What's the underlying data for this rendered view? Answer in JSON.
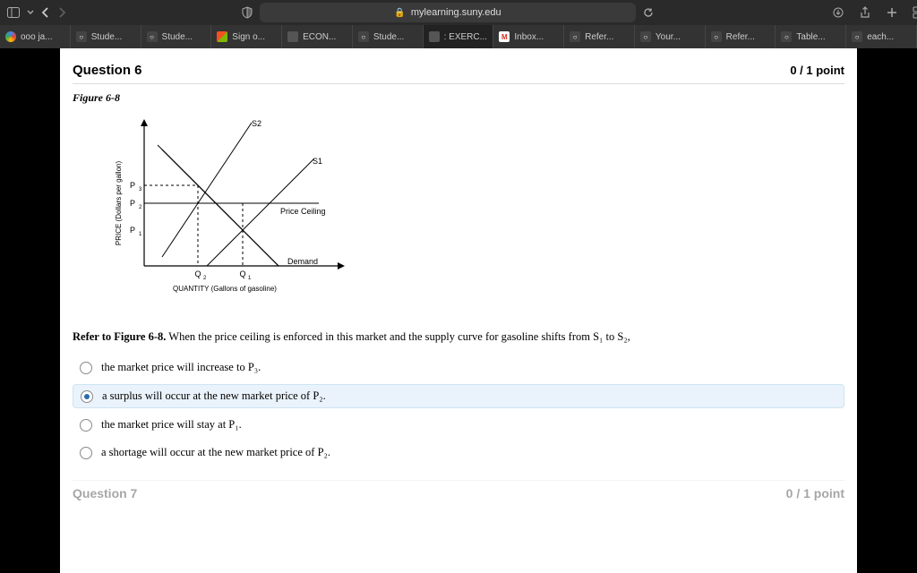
{
  "browser": {
    "address": "mylearning.suny.edu",
    "tabs": [
      {
        "label": "ооо ја...",
        "favicon": "g"
      },
      {
        "label": "Stude...",
        "favicon": "sq"
      },
      {
        "label": "Stude...",
        "favicon": "sq"
      },
      {
        "label": "Sign o...",
        "favicon": "ms"
      },
      {
        "label": "ECON...",
        "favicon": "dark"
      },
      {
        "label": "Stude...",
        "favicon": "sq"
      },
      {
        "label": ": EXERC...",
        "favicon": "dark",
        "active": true
      },
      {
        "label": "Inbox...",
        "favicon": "gmail"
      },
      {
        "label": "Refer...",
        "favicon": "sq"
      },
      {
        "label": "Your...",
        "favicon": "sq"
      },
      {
        "label": "Refer...",
        "favicon": "sq"
      },
      {
        "label": "Table...",
        "favicon": "sq"
      },
      {
        "label": "each...",
        "favicon": "sq"
      }
    ]
  },
  "question": {
    "title": "Question 6",
    "points": "0 / 1 point",
    "figure_label": "Figure 6-8",
    "prompt_bold": "Refer to Figure 6-8.",
    "prompt_rest": " When the price ceiling is enforced in this market and the supply curve for gasoline shifts from S₁ to S₂,",
    "options": [
      {
        "text": "the market price will increase to P₃.",
        "selected": false
      },
      {
        "text": "a surplus will occur at the new market price of P₂.",
        "selected": true
      },
      {
        "text": "the market price will stay at P₁.",
        "selected": false
      },
      {
        "text": "a shortage will occur at the new market price of P₂.",
        "selected": false
      }
    ]
  },
  "chart_data": {
    "type": "line",
    "title": "",
    "xlabel": "QUANTITY (Gallons of gasoline)",
    "ylabel": "PRICE (Dollars per gallon)",
    "x_categories": [
      "Q2",
      "Q1"
    ],
    "y_categories": [
      "P1",
      "P2",
      "P3"
    ],
    "series": [
      {
        "name": "S2",
        "type": "supply"
      },
      {
        "name": "S1",
        "type": "supply"
      },
      {
        "name": "Demand",
        "type": "demand"
      },
      {
        "name": "Price Ceiling",
        "type": "horizontal",
        "at": "P2"
      }
    ],
    "annotations": [
      "S2",
      "S1",
      "Price Ceiling",
      "Demand"
    ],
    "guides": [
      {
        "from_y": "P3",
        "to_x": "Q2"
      },
      {
        "from_y": "P2",
        "to_x": "Q2"
      }
    ]
  },
  "next_question": {
    "title": "Question 7",
    "points": "0 / 1 point"
  }
}
